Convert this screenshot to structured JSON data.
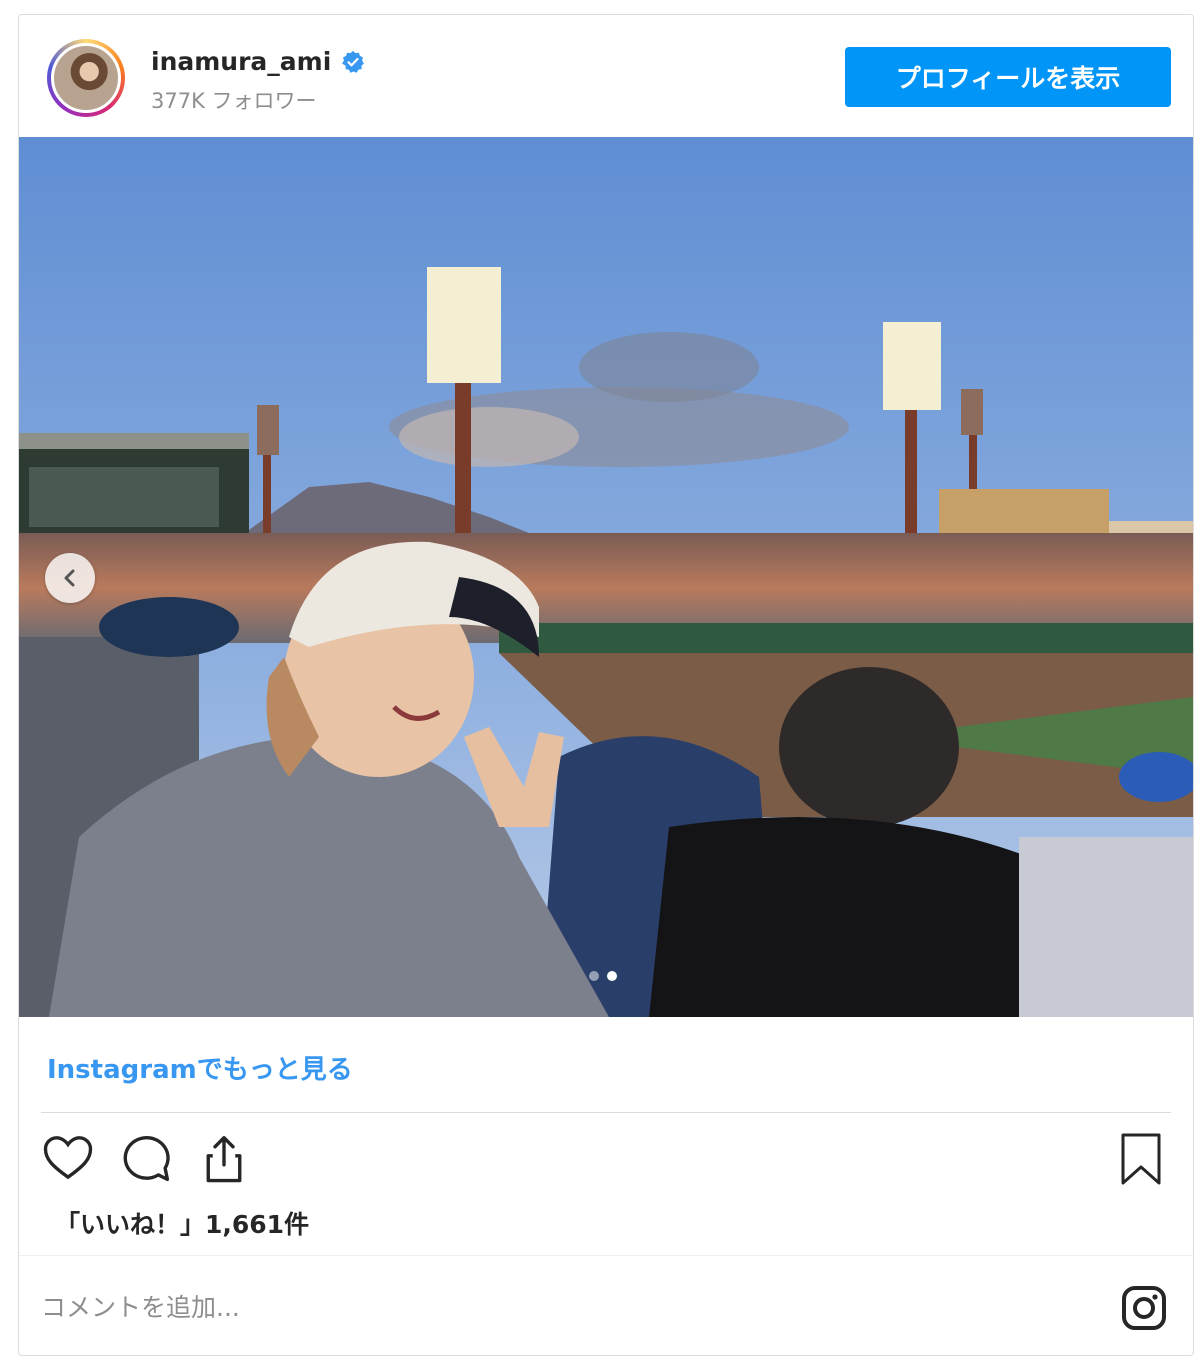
{
  "header": {
    "username": "inamura_ami",
    "followers": "377K フォロワー",
    "profile_button": "プロフィールを表示"
  },
  "post": {
    "more_link": "Instagramでもっと見る",
    "likes": "「いいね！」1,661件",
    "comment_placeholder": "コメントを追加...",
    "carousel": {
      "slide_count": 2,
      "active_index": 1
    }
  },
  "icons": {
    "verified": "verified-badge-icon",
    "like": "heart-icon",
    "comment": "comment-icon",
    "share": "share-icon",
    "save": "bookmark-icon",
    "instagram": "instagram-logo-icon",
    "carousel_prev": "chevron-left-icon"
  },
  "colors": {
    "accent": "#0095f6",
    "link": "#3897f0",
    "verified": "#3897f0"
  }
}
